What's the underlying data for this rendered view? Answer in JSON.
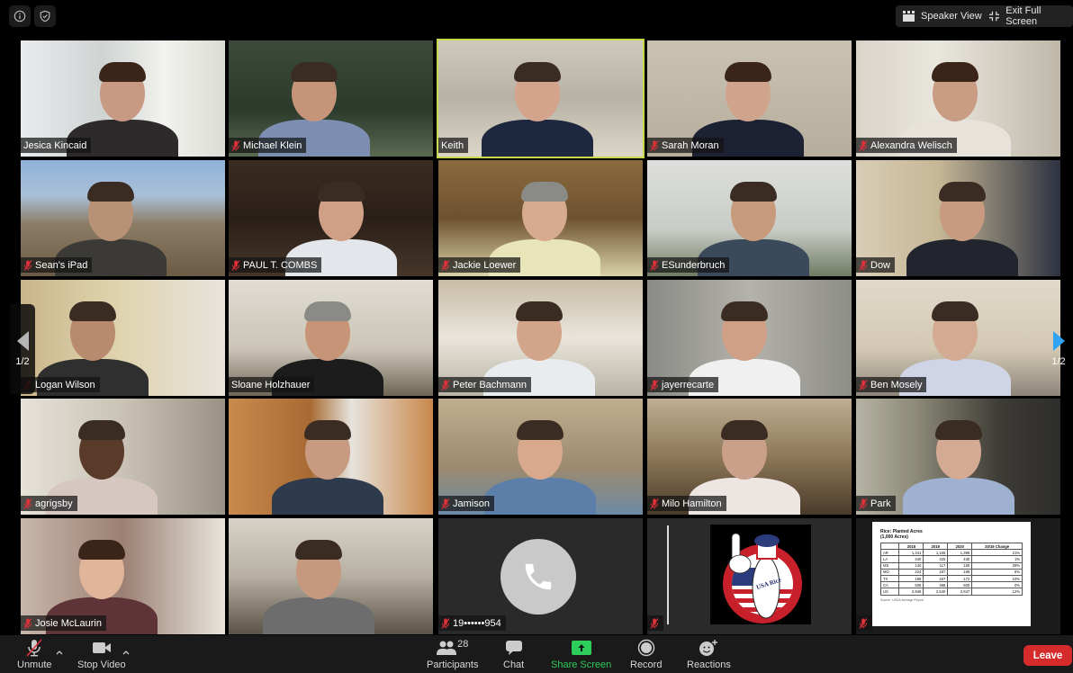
{
  "top_bar": {
    "info_icon": "info-icon",
    "security_icon": "shield-check-icon",
    "speaker_view_label": "Speaker View",
    "exit_fullscreen_label": "Exit Full Screen"
  },
  "pager": {
    "left_label": "1/2",
    "right_label": "1/2",
    "accent": "#2fa3f5"
  },
  "active_speaker_border": "#c8d94a",
  "participants": [
    {
      "name": "Jesica Kincaid",
      "muted": false
    },
    {
      "name": "Michael Klein",
      "muted": true
    },
    {
      "name": "Keith",
      "muted": false,
      "active": true
    },
    {
      "name": "Sarah Moran",
      "muted": true
    },
    {
      "name": "Alexandra Welisch",
      "muted": true
    },
    {
      "name": "Sean's iPad",
      "muted": true
    },
    {
      "name": "PAUL T. COMBS",
      "muted": true
    },
    {
      "name": "Jackie Loewer",
      "muted": true
    },
    {
      "name": "ESunderbruch",
      "muted": true
    },
    {
      "name": "Dow",
      "muted": true
    },
    {
      "name": "Logan Wilson",
      "muted": true
    },
    {
      "name": "Sloane Holzhauer",
      "muted": false
    },
    {
      "name": "Peter Bachmann",
      "muted": true
    },
    {
      "name": "jayerrecarte",
      "muted": true
    },
    {
      "name": "Ben Mosely",
      "muted": true
    },
    {
      "name": "agrigsby",
      "muted": true
    },
    {
      "name": "",
      "muted": false
    },
    {
      "name": "Jamison",
      "muted": true
    },
    {
      "name": "Milo Hamilton",
      "muted": true
    },
    {
      "name": "Park",
      "muted": true
    },
    {
      "name": "Josie McLaurin",
      "muted": true
    },
    {
      "name": "",
      "muted": false
    },
    {
      "name": "19••••••954",
      "muted": true,
      "phone": true
    },
    {
      "name": "",
      "muted": true,
      "logo": "USA Rice"
    },
    {
      "name": "",
      "muted": true,
      "slide": true
    }
  ],
  "slide": {
    "title": "Rice: Planted Acres",
    "subtitle": "(1,000 Acres)",
    "headers": [
      "",
      "2018",
      "2019",
      "2020",
      "20/19 Change"
    ],
    "rows": [
      [
        "AR",
        "1,441",
        "1,156",
        "1,396",
        "21%"
      ],
      [
        "LA",
        "440",
        "425",
        "430",
        "1%"
      ],
      [
        "MS",
        "140",
        "117",
        "150",
        "28%"
      ],
      [
        "MO",
        "224",
        "187",
        "199",
        "6%"
      ],
      [
        "TX",
        "195",
        "157",
        "172",
        "10%"
      ],
      [
        "CA",
        "506",
        "498",
        "500",
        "0%"
      ],
      [
        "US",
        "2,946",
        "2,540",
        "2,847",
        "12%"
      ]
    ],
    "source": "Source: USDA Acreage Report"
  },
  "logo_tile": {
    "text": "USA Rice"
  },
  "toolbar": {
    "unmute_label": "Unmute",
    "stop_video_label": "Stop Video",
    "participants_label": "Participants",
    "participants_count": "28",
    "chat_label": "Chat",
    "share_screen_label": "Share Screen",
    "record_label": "Record",
    "reactions_label": "Reactions",
    "leave_label": "Leave",
    "share_color": "#2ecc5a",
    "leave_color": "#d52b2b"
  }
}
